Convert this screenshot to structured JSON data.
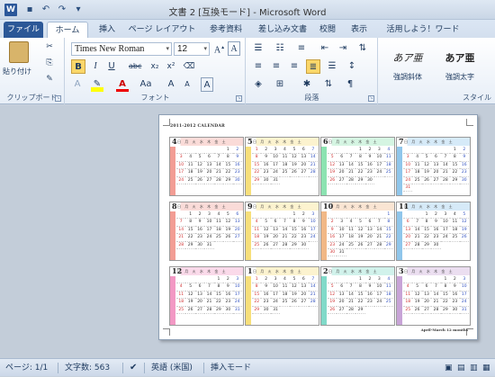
{
  "window": {
    "title": "文書 2 [互換モード] - Microsoft Word",
    "app_icon": "W"
  },
  "quick_access": [
    {
      "name": "save-icon",
      "glyph": "💾"
    },
    {
      "name": "undo-icon",
      "glyph": "↶"
    },
    {
      "name": "redo-icon",
      "glyph": "↷"
    },
    {
      "name": "customize-icon",
      "glyph": "▾"
    }
  ],
  "tabs": [
    "ファイル",
    "ホーム",
    "挿入",
    "ページ レイアウト",
    "参考資料",
    "差し込み文書",
    "校閲",
    "表示",
    "活用しよう！ワード"
  ],
  "clipboard": {
    "label": "クリップボード",
    "paste": "貼り付け"
  },
  "font": {
    "label": "フォント",
    "name": "Times New Roman",
    "size": "12",
    "bold": "B",
    "italic": "I",
    "underline": "U",
    "strike": "abc",
    "sub": "x₂",
    "sup": "x²",
    "grow": "A",
    "shrink": "A",
    "clear": "A",
    "color": "A",
    "case": "Aa"
  },
  "paragraph": {
    "label": "段落"
  },
  "styles": {
    "label": "スタイル",
    "items": [
      {
        "sample": "あア亜",
        "name": "強調斜体"
      },
      {
        "sample": "あア亜",
        "name": "強調太字"
      }
    ]
  },
  "status": {
    "page": "ページ: 1/1",
    "words": "文字数: 563",
    "lang": "英語 (米国)",
    "mode": "挿入モード"
  },
  "doc": {
    "title": "2011-2012 CALENDAR",
    "footer": "April-March  12 months",
    "dow": "日 月 火 水 木 金 土"
  },
  "months": [
    {
      "m": "4",
      "color": "#e74c3c",
      "days": [
        "",
        "",
        "",
        "",
        "",
        "1",
        "2",
        "3",
        "4",
        "5",
        "6",
        "7",
        "8",
        "9",
        "10",
        "11",
        "12",
        "13",
        "14",
        "15",
        "16",
        "17",
        "18",
        "19",
        "20",
        "21",
        "22",
        "23",
        "24",
        "25",
        "26",
        "27",
        "28",
        "29",
        "30"
      ]
    },
    {
      "m": "5",
      "color": "#f1c40f",
      "days": [
        "1",
        "2",
        "3",
        "4",
        "5",
        "6",
        "7",
        "8",
        "9",
        "10",
        "11",
        "12",
        "13",
        "14",
        "15",
        "16",
        "17",
        "18",
        "19",
        "20",
        "21",
        "22",
        "23",
        "24",
        "25",
        "26",
        "27",
        "28",
        "29",
        "30",
        "31"
      ]
    },
    {
      "m": "6",
      "color": "#2ecc71",
      "days": [
        "",
        "",
        "",
        "1",
        "2",
        "3",
        "4",
        "5",
        "6",
        "7",
        "8",
        "9",
        "10",
        "11",
        "12",
        "13",
        "14",
        "15",
        "16",
        "17",
        "18",
        "19",
        "20",
        "21",
        "22",
        "23",
        "24",
        "25",
        "26",
        "27",
        "28",
        "29",
        "30"
      ]
    },
    {
      "m": "7",
      "color": "#3498db",
      "days": [
        "",
        "",
        "",
        "",
        "",
        "1",
        "2",
        "3",
        "4",
        "5",
        "6",
        "7",
        "8",
        "9",
        "10",
        "11",
        "12",
        "13",
        "14",
        "15",
        "16",
        "17",
        "18",
        "19",
        "20",
        "21",
        "22",
        "23",
        "24",
        "25",
        "26",
        "27",
        "28",
        "29",
        "30",
        "31"
      ]
    },
    {
      "m": "8",
      "color": "#e74c3c",
      "days": [
        "",
        "1",
        "2",
        "3",
        "4",
        "5",
        "6",
        "7",
        "8",
        "9",
        "10",
        "11",
        "12",
        "13",
        "14",
        "15",
        "16",
        "17",
        "18",
        "19",
        "20",
        "21",
        "22",
        "23",
        "24",
        "25",
        "26",
        "27",
        "28",
        "29",
        "30",
        "31"
      ]
    },
    {
      "m": "9",
      "color": "#f1c40f",
      "days": [
        "",
        "",
        "",
        "",
        "1",
        "2",
        "3",
        "4",
        "5",
        "6",
        "7",
        "8",
        "9",
        "10",
        "11",
        "12",
        "13",
        "14",
        "15",
        "16",
        "17",
        "18",
        "19",
        "20",
        "21",
        "22",
        "23",
        "24",
        "25",
        "26",
        "27",
        "28",
        "29",
        "30"
      ]
    },
    {
      "m": "10",
      "color": "#e67e22",
      "days": [
        "",
        "",
        "",
        "",
        "",
        "",
        "1",
        "2",
        "3",
        "4",
        "5",
        "6",
        "7",
        "8",
        "9",
        "10",
        "11",
        "12",
        "13",
        "14",
        "15",
        "16",
        "17",
        "18",
        "19",
        "20",
        "21",
        "22",
        "23",
        "24",
        "25",
        "26",
        "27",
        "28",
        "29",
        "30",
        "31"
      ]
    },
    {
      "m": "11",
      "color": "#3498db",
      "days": [
        "",
        "",
        "1",
        "2",
        "3",
        "4",
        "5",
        "6",
        "7",
        "8",
        "9",
        "10",
        "11",
        "12",
        "13",
        "14",
        "15",
        "16",
        "17",
        "18",
        "19",
        "20",
        "21",
        "22",
        "23",
        "24",
        "25",
        "26",
        "27",
        "28",
        "29",
        "30"
      ]
    },
    {
      "m": "12",
      "color": "#e84393",
      "days": [
        "",
        "",
        "",
        "",
        "1",
        "2",
        "3",
        "4",
        "5",
        "6",
        "7",
        "8",
        "9",
        "10",
        "11",
        "12",
        "13",
        "14",
        "15",
        "16",
        "17",
        "18",
        "19",
        "20",
        "21",
        "22",
        "23",
        "24",
        "25",
        "26",
        "27",
        "28",
        "29",
        "30",
        "31"
      ]
    },
    {
      "m": "1",
      "color": "#f1c40f",
      "days": [
        "1",
        "2",
        "3",
        "4",
        "5",
        "6",
        "7",
        "8",
        "9",
        "10",
        "11",
        "12",
        "13",
        "14",
        "15",
        "16",
        "17",
        "18",
        "19",
        "20",
        "21",
        "22",
        "23",
        "24",
        "25",
        "26",
        "27",
        "28",
        "29",
        "30",
        "31"
      ]
    },
    {
      "m": "2",
      "color": "#1abc9c",
      "days": [
        "",
        "",
        "",
        "1",
        "2",
        "3",
        "4",
        "5",
        "6",
        "7",
        "8",
        "9",
        "10",
        "11",
        "12",
        "13",
        "14",
        "15",
        "16",
        "17",
        "18",
        "19",
        "20",
        "21",
        "22",
        "23",
        "24",
        "25",
        "26",
        "27",
        "28",
        "29"
      ]
    },
    {
      "m": "3",
      "color": "#9b59b6",
      "days": [
        "",
        "",
        "",
        "",
        "1",
        "2",
        "3",
        "4",
        "5",
        "6",
        "7",
        "8",
        "9",
        "10",
        "11",
        "12",
        "13",
        "14",
        "15",
        "16",
        "17",
        "18",
        "19",
        "20",
        "21",
        "22",
        "23",
        "24",
        "25",
        "26",
        "27",
        "28",
        "29",
        "30",
        "31"
      ]
    }
  ]
}
